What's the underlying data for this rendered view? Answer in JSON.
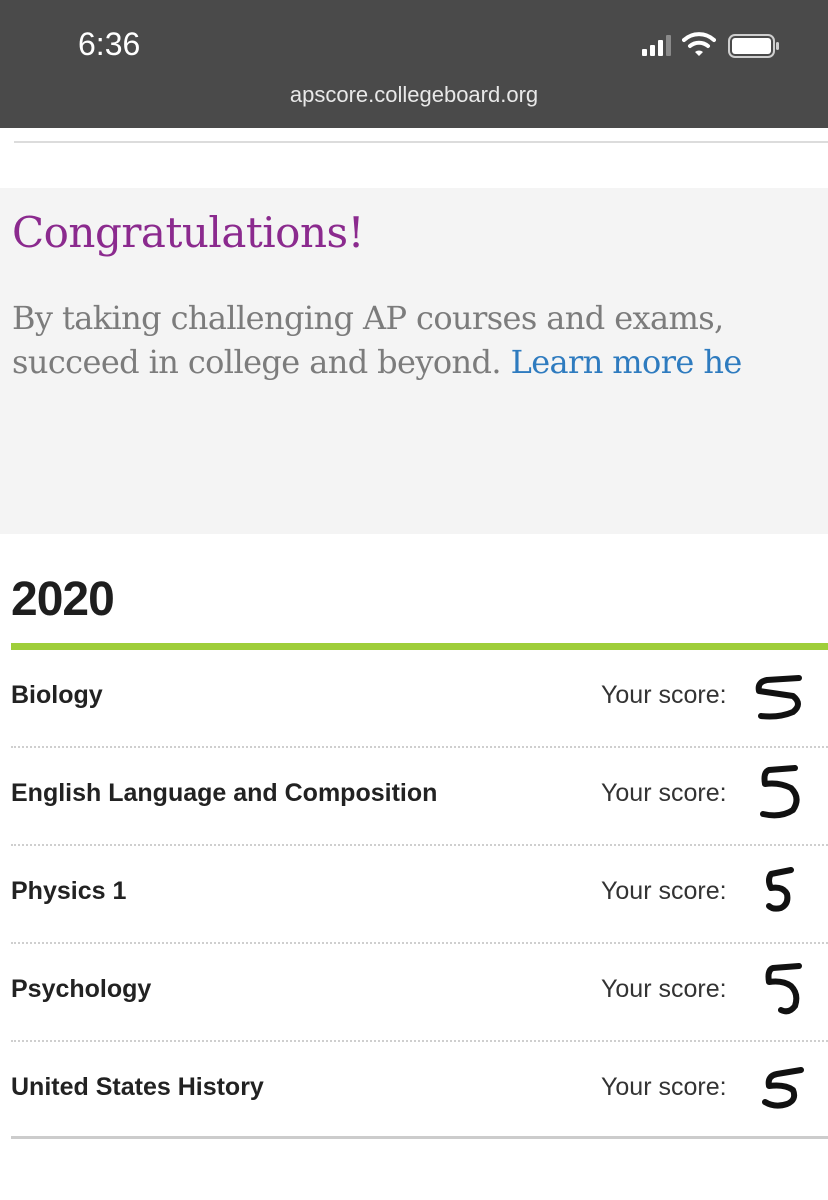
{
  "status_bar": {
    "time": "6:36",
    "url": "apscore.collegeboard.org",
    "icons": [
      "signal-icon",
      "wifi-icon",
      "battery-icon"
    ]
  },
  "congrats": {
    "title": "Congratulations!",
    "line1": "By taking challenging AP courses and exams,",
    "line2_text": "succeed in college and beyond. ",
    "link_text": "Learn more he",
    "colors": {
      "title": "#8b2a8e",
      "text": "#7c7c7c",
      "link": "#2e7bbf",
      "background": "#f4f4f4"
    }
  },
  "scores": {
    "year": "2020",
    "accent_color": "#9fce3a",
    "items": [
      {
        "subject": "Biology",
        "label": "Your score:",
        "score": "5"
      },
      {
        "subject": "English Language and Composition",
        "label": "Your score:",
        "score": "5"
      },
      {
        "subject": "Physics 1",
        "label": "Your score:",
        "score": "5"
      },
      {
        "subject": "Psychology",
        "label": "Your score:",
        "score": "5"
      },
      {
        "subject": "United States History",
        "label": "Your score:",
        "score": "5"
      }
    ]
  }
}
